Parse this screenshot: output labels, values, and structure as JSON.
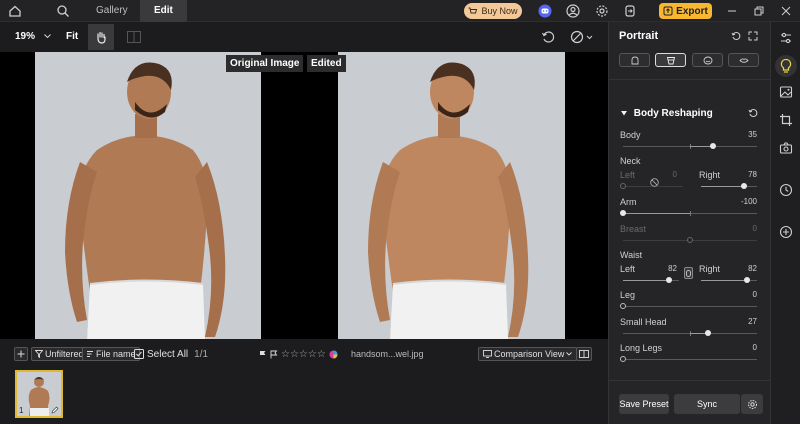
{
  "topbar": {
    "tabs": [
      {
        "label": "Gallery"
      },
      {
        "label": "Edit"
      }
    ],
    "buy_label": "Buy Now",
    "export_label": "Export"
  },
  "toolbar": {
    "zoom": "19%",
    "fit_label": "Fit"
  },
  "canvas": {
    "original_label": "Original Image",
    "edited_label": "Edited"
  },
  "strip": {
    "filter_label": "Unfiltered",
    "sort_label": "File name",
    "select_all_label": "Select All",
    "count": "1/1",
    "filename": "handsom...wel.jpg",
    "view_label": "Comparison View",
    "thumb_index": "1"
  },
  "panel": {
    "title": "Portrait",
    "section_title": "Body Reshaping",
    "rows": {
      "body": {
        "label": "Body",
        "value": "35"
      },
      "neck": {
        "label": "Neck",
        "left_label": "Left",
        "left_value": "0",
        "right_label": "Right",
        "right_value": "78"
      },
      "arm": {
        "label": "Arm",
        "value": "-100"
      },
      "breast": {
        "label": "Breast",
        "value": "0"
      },
      "waist": {
        "label": "Waist",
        "left_label": "Left",
        "left_value": "82",
        "right_label": "Right",
        "right_value": "82"
      },
      "leg": {
        "label": "Leg",
        "value": "0"
      },
      "small_head": {
        "label": "Small Head",
        "value": "27"
      },
      "long_legs": {
        "label": "Long Legs",
        "value": "0"
      }
    },
    "save_preset_label": "Save Preset",
    "sync_label": "Sync"
  },
  "colors": {
    "accent_yellow": "#f7b731",
    "buy_bg": "#f4c99a",
    "discord": "#5865f2",
    "active_tool": "#e8d44d"
  }
}
